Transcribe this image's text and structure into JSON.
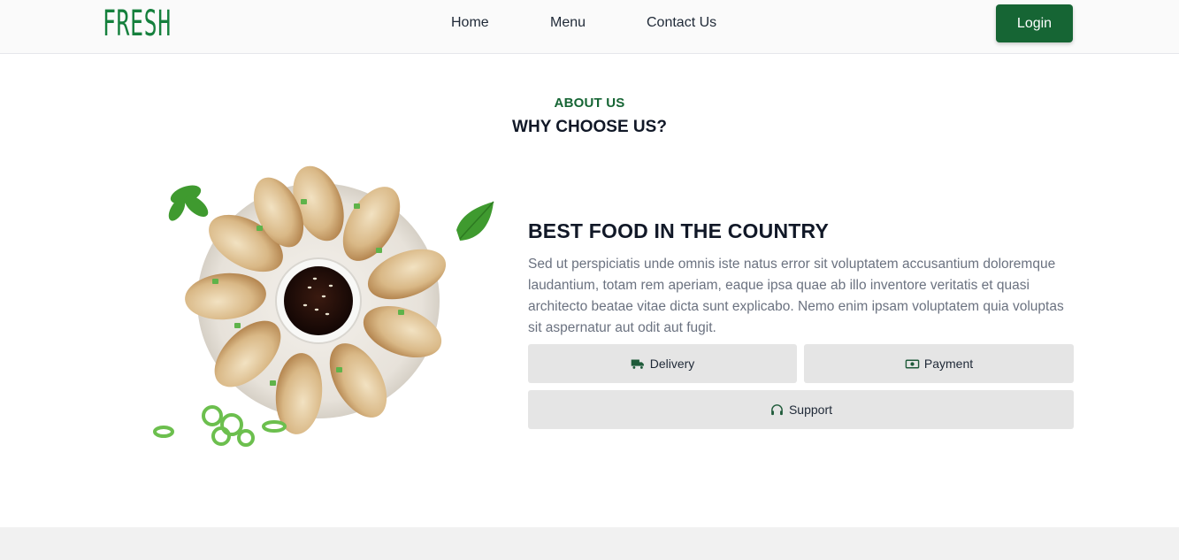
{
  "header": {
    "logo": "FRESH",
    "nav": {
      "home": "Home",
      "menu": "Menu",
      "contact": "Contact Us"
    },
    "login_label": "Login"
  },
  "about": {
    "label": "ABOUT US",
    "title": "WHY CHOOSE US?"
  },
  "feature": {
    "title": "BEST FOOD IN THE COUNTRY",
    "text": "Sed ut perspiciatis unde omnis iste natus error sit voluptatem accusantium doloremque laudantium, totam rem aperiam, eaque ipsa quae ab illo inventore veritatis et quasi architecto beatae vitae dicta sunt explicabo. Nemo enim ipsam voluptatem quia voluptas sit aspernatur aut odit aut fugit.",
    "chips": {
      "delivery": {
        "label": "Delivery",
        "icon": "truck-icon"
      },
      "payment": {
        "label": "Payment",
        "icon": "money-icon"
      },
      "support": {
        "label": "Support",
        "icon": "headset-icon"
      }
    }
  },
  "colors": {
    "brand_green": "#166534",
    "logo_green": "#15803d",
    "chip_bg": "#e5e5e5"
  }
}
